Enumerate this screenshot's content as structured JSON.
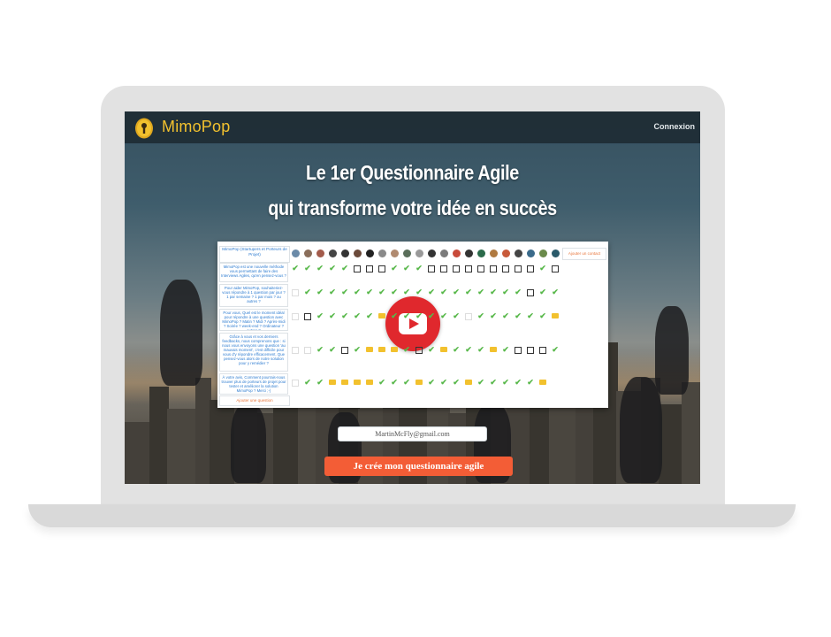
{
  "app": {
    "brand_name": "MimoPop",
    "login_label": "Connexion"
  },
  "hero": {
    "headline_line1": "Le 1er Questionnaire Agile",
    "headline_line2": "qui transforme votre idée en succès"
  },
  "video_preview": {
    "header_label": "MimoPop (Startupers et Porteurs de Projet)",
    "add_contact_label": "Ajouter un contact",
    "add_question_label": "Ajouter une question",
    "questions": [
      "MimoPop est une nouvelle méthode vous permettant de faire des Interviews Agiles, qu'en pensez-vous ?",
      "Pour aider MimoPop, souhaiteriez-vous répondre à 1 question par jour ? 1 par semaine ? 1 par mois ? ou autres ?",
      "Pour vous, Quel est le moment idéal pour répondre à une question avec MimoPop ? Matin ? Midi ? Après-midi ? Soirée ? week-end ? Ordinateur ? autres ?",
      "Grâce à vous et vos derniers feedbacks, nous comprenons que : si nous vous envoyons une question 'au mauvais moment', c'est difficile pour vous d'y répondre efficacement. Que pensez-vous alors de notre solution pour y remédier ?",
      "À votre avis, Comment pourrais-nous trouver plus de porteurs de projet pour tester et améliorer la solution MimoPop ? Merci ;-)"
    ],
    "play_icon": "youtube-play-icon"
  },
  "signup": {
    "email_value": "MartinMcFly@gmail.com",
    "cta_label": "Je crée mon questionnaire agile"
  },
  "colors": {
    "accent": "#f35d36",
    "brand_yellow": "#f2c12e",
    "play_red": "#e0282d",
    "check_green": "#58b84a"
  }
}
